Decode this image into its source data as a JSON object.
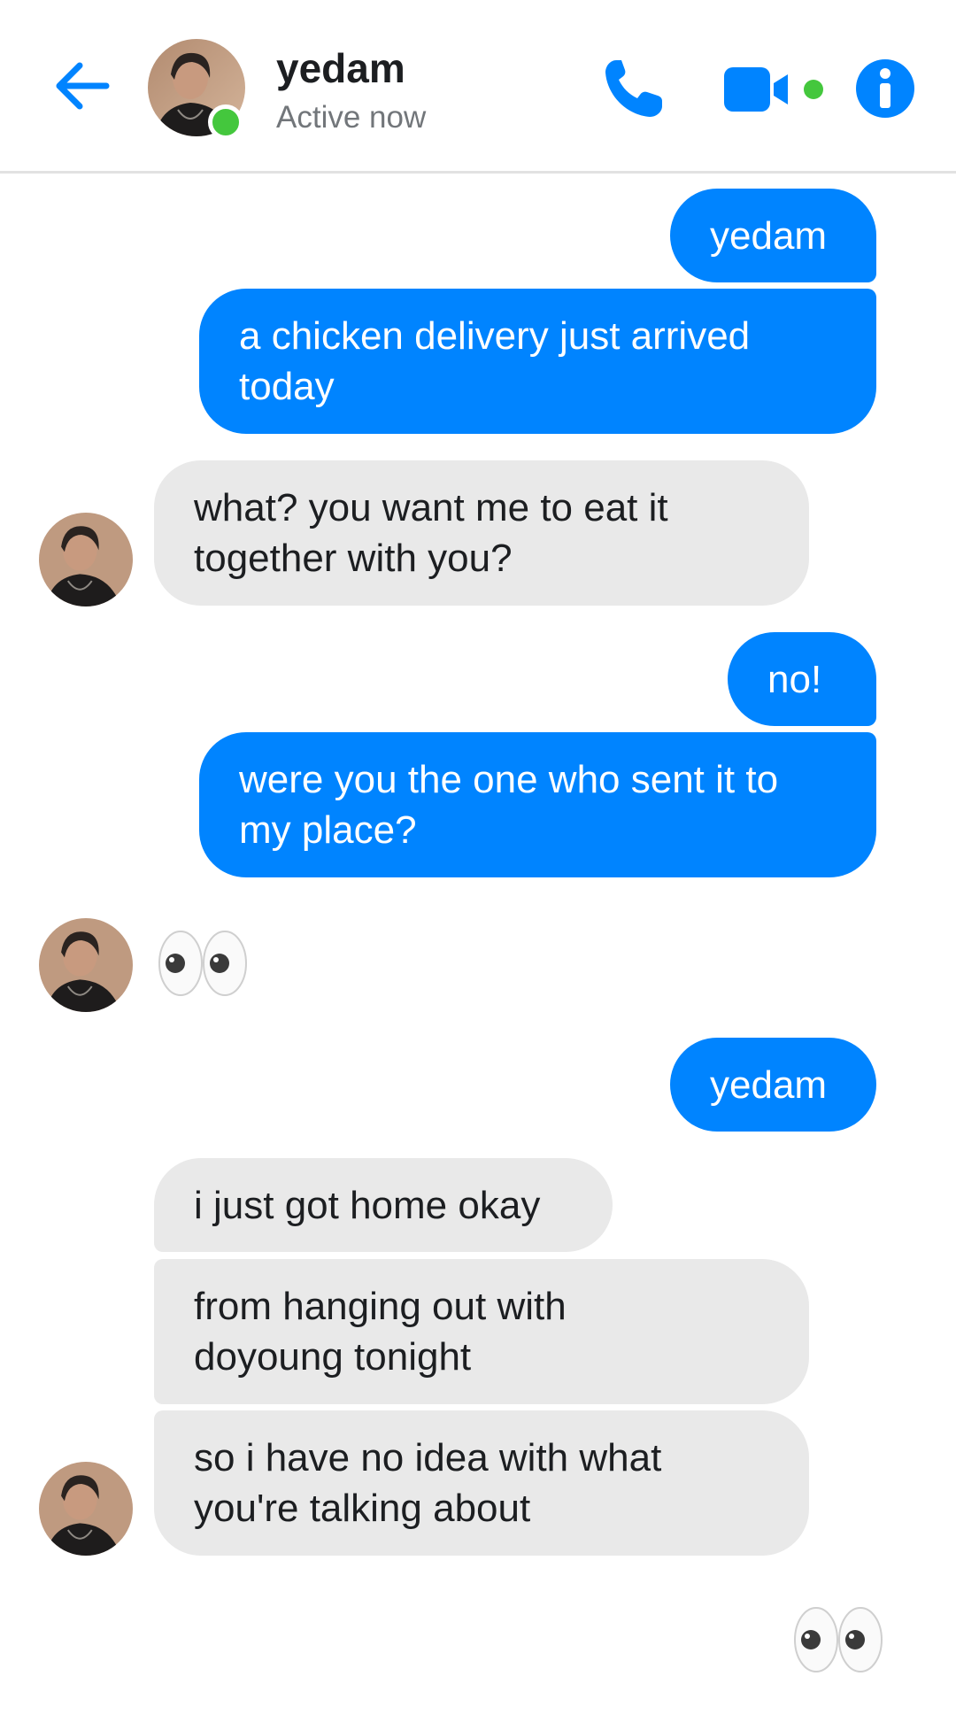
{
  "header": {
    "contact_name": "yedam",
    "status": "Active now",
    "icons": {
      "back": "back-arrow-icon",
      "call": "phone-icon",
      "video": "video-camera-icon",
      "info": "info-icon"
    }
  },
  "colors": {
    "accent": "#0084ff",
    "incoming_bubble": "#e9e9e9",
    "online": "#44c73d"
  },
  "messages": [
    {
      "from": "me",
      "text": "yedam"
    },
    {
      "from": "me",
      "text": "a chicken delivery just arrived\ntoday"
    },
    {
      "from": "them",
      "text": "what? you want me to eat it\ntogether with you?"
    },
    {
      "from": "me",
      "text": "no!"
    },
    {
      "from": "me",
      "text": "were you the one who sent it to\nmy place?"
    },
    {
      "from": "them",
      "emoji": "eyes"
    },
    {
      "from": "me",
      "text": "yedam"
    },
    {
      "from": "them",
      "text": "i just got home okay"
    },
    {
      "from": "them",
      "text": "from hanging out with\ndoyoung tonight"
    },
    {
      "from": "them",
      "text": "so i have no idea with what\nyou're talking about"
    },
    {
      "from": "me",
      "emoji": "eyes"
    }
  ]
}
